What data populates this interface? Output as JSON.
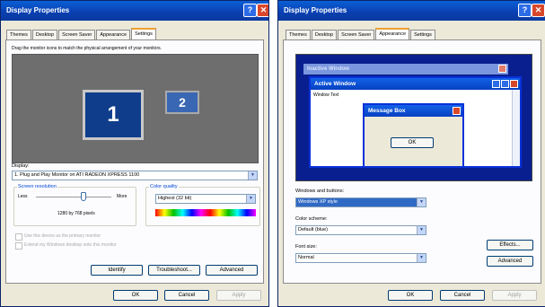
{
  "left": {
    "title": "Display Properties",
    "tabs": [
      "Themes",
      "Desktop",
      "Screen Saver",
      "Appearance",
      "Settings"
    ],
    "instruction": "Drag the monitor icons to match the physical arrangement of your monitors.",
    "monitor_primary": "1",
    "monitor_secondary": "2",
    "display_label": "Display:",
    "display_value": "1. Plug and Play Monitor on ATI RADEON XPRESS 1100",
    "resolution_label": "Screen resolution",
    "less": "Less",
    "more": "More",
    "resolution_value": "1280 by 768 pixels",
    "color_quality_label": "Color quality",
    "color_quality_value": "Highest (32 bit)",
    "checkbox1": "Use this device as the primary monitor",
    "checkbox2": "Extend my Windows desktop onto this monitor",
    "identify": "Identify",
    "troubleshoot": "Troubleshoot...",
    "advanced": "Advanced",
    "ok": "OK",
    "cancel": "Cancel",
    "apply": "Apply"
  },
  "right": {
    "title": "Display Properties",
    "tabs": [
      "Themes",
      "Desktop",
      "Screen Saver",
      "Appearance",
      "Settings"
    ],
    "preview_inactive": "Inactive Window",
    "preview_active": "Active Window",
    "preview_window_text": "Window Text",
    "preview_message_box": "Message Box",
    "preview_ok": "OK",
    "windows_buttons_label": "Windows and buttons:",
    "windows_buttons_value": "Windows XP style",
    "color_scheme_label": "Color scheme:",
    "color_scheme_value": "Default (blue)",
    "font_size_label": "Font size:",
    "font_size_value": "Normal",
    "effects": "Effects...",
    "advanced": "Advanced",
    "ok": "OK",
    "cancel": "Cancel",
    "apply": "Apply"
  },
  "colors": {
    "desktop_gray": "#6e6e6e",
    "monitor_blue": "#0f3d8c",
    "xp_title_blue": "#0a4fc8",
    "preview_navy": "#0a1f8f"
  }
}
